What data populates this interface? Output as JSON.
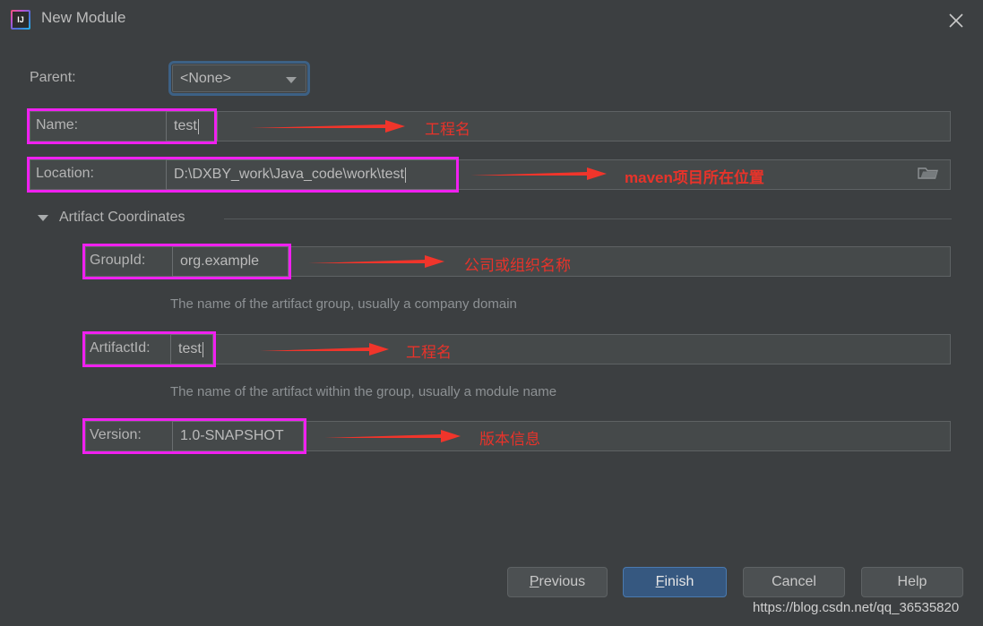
{
  "window": {
    "title": "New Module",
    "app_icon": "intellij-idea-icon",
    "icon_text": "IJ",
    "close_icon": "close-icon"
  },
  "form": {
    "parent": {
      "label": "Parent:",
      "value": "<None>",
      "dropdown_icon": "chevron-down-icon"
    },
    "name": {
      "label": "Name:",
      "value": "test"
    },
    "location": {
      "label": "Location:",
      "value": "D:\\DXBY_work\\Java_code\\work\\test",
      "browse_icon": "folder-icon"
    },
    "artifact_coordinates": {
      "section_title": "Artifact Coordinates",
      "collapse_icon": "triangle-down-icon",
      "group_id": {
        "label": "GroupId:",
        "value": "org.example",
        "helper": "The name of the artifact group, usually a company domain"
      },
      "artifact_id": {
        "label": "ArtifactId:",
        "value": "test",
        "helper": "The name of the artifact within the group, usually a module name"
      },
      "version": {
        "label": "Version:",
        "value": "1.0-SNAPSHOT"
      }
    }
  },
  "annotations": [
    {
      "text": "工程名"
    },
    {
      "text": "maven项目所在位置"
    },
    {
      "text": "公司或组织名称"
    },
    {
      "text": "工程名"
    },
    {
      "text": "版本信息"
    }
  ],
  "buttons": {
    "previous": "Previous",
    "previous_mnemonic": "P",
    "previous_rest": "revious",
    "finish": "Finish",
    "finish_mnemonic": "F",
    "finish_rest": "inish",
    "cancel": "Cancel",
    "help": "Help"
  },
  "watermark": "https://blog.csdn.net/qq_36535820",
  "colors": {
    "background": "#3c3f41",
    "field": "#45494a",
    "accent_blue": "#365880",
    "focus_ring": "#3d6185",
    "annotation_red": "#e8332a",
    "highlight_magenta": "#f020f0"
  }
}
